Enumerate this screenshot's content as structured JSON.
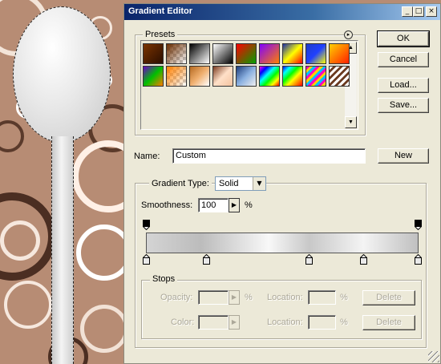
{
  "dialog": {
    "title": "Gradient Editor",
    "title_buttons": [
      "_",
      "□",
      "×"
    ]
  },
  "presets": {
    "label": "Presets",
    "menu_icon": "circle-arrow-icon",
    "swatches": [
      {
        "from": "#7a3300",
        "to": "#2a0e00"
      },
      {
        "from": "#6b2d00",
        "to": "#c6ced6",
        "mode": "transparent"
      },
      {
        "from": "#000000",
        "to": "#ffffff"
      },
      {
        "from": "#ffffff",
        "to": "#000000",
        "mode": "rev"
      },
      {
        "from": "#ff0000",
        "to": "#00a000"
      },
      {
        "from": "#8000ff",
        "to": "#ff8000"
      },
      {
        "from": "#1c2ea8",
        "to": "#ff0000",
        "mid": "#ffff00"
      },
      {
        "from": "#1f3dc8",
        "to": "#ffff00",
        "mid": "#2040ff"
      },
      {
        "from": "#ffd000",
        "to": "#ff2000"
      },
      {
        "from": "#6a00c8",
        "to": "#ff7a00",
        "mid": "#00c000"
      },
      {
        "from": "#ff8000",
        "to": "#d8d8d8",
        "mid": "#ffd000",
        "mode": "transparent"
      },
      {
        "from": "#b66a20",
        "to": "#ffffff",
        "mid": "#f0b070"
      },
      {
        "from": "#7a3b20",
        "to": "#f3c3a0",
        "mid": "#ffe0c8"
      },
      {
        "from": "#1c3c7a",
        "to": "#f0f0f0",
        "mid": "#8ab0e0"
      },
      {
        "from": "#ff00ff",
        "to": "#ffff00",
        "mode": "rainbow"
      },
      {
        "from": "#ff0000",
        "to": "#0000ff",
        "mode": "rainbow2"
      },
      {
        "from": "#ff00c0",
        "to": "#ffd000",
        "mode": "stripes"
      },
      {
        "from": "#ffffff",
        "to": "#6b3a20",
        "mode": "diag"
      }
    ]
  },
  "buttons": {
    "ok": "OK",
    "cancel": "Cancel",
    "load": "Load...",
    "save": "Save...",
    "new": "New",
    "delete_opacity": "Delete",
    "delete_color": "Delete"
  },
  "name_field": {
    "label": "Name:",
    "value": "Custom"
  },
  "gradient": {
    "type_label": "Gradient Type:",
    "type_value": "Solid",
    "smoothness_label": "Smoothness:",
    "smoothness_value": "100",
    "smoothness_unit": "%",
    "opacity_stops": [
      0,
      100
    ],
    "color_stops": [
      0,
      22,
      60,
      80,
      100
    ]
  },
  "stops": {
    "label": "Stops",
    "opacity_label": "Opacity:",
    "opacity_unit": "%",
    "location_label": "Location:",
    "location_unit": "%",
    "color_label": "Color:",
    "location2_label": "Location:",
    "location2_unit": "%"
  }
}
